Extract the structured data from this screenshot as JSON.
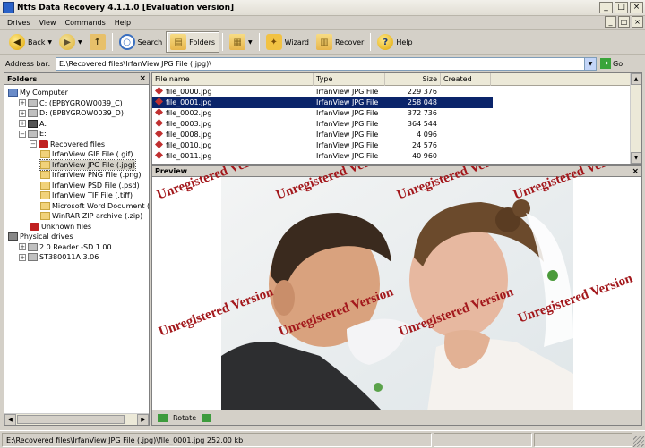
{
  "window": {
    "title": "Ntfs Data Recovery 4.1.1.0 [Evaluation version]",
    "btn_min": "_",
    "btn_max": "□",
    "btn_close": "×"
  },
  "menu": {
    "items": [
      "Drives",
      "View",
      "Commands",
      "Help"
    ]
  },
  "toolbar": {
    "back": "Back",
    "search": "Search",
    "folders": "Folders",
    "wizard": "Wizard",
    "recover": "Recover",
    "help": "Help"
  },
  "address": {
    "label": "Address bar:",
    "value": "E:\\Recovered files\\IrfanView JPG File (.jpg)\\",
    "go": "Go"
  },
  "folders": {
    "title": "Folders",
    "tree": [
      {
        "label": "My Computer",
        "icon": "computer-icon",
        "indent": 0,
        "exp": ""
      },
      {
        "label": "C: (EPBYGROW0039_C)",
        "icon": "drive-icon",
        "indent": 1,
        "exp": "+"
      },
      {
        "label": "D: (EPBYGROW0039_D)",
        "icon": "drive-icon",
        "indent": 1,
        "exp": "+"
      },
      {
        "label": "A:",
        "icon": "floppy-icon",
        "indent": 1,
        "exp": "+"
      },
      {
        "label": "E:",
        "icon": "drive-icon",
        "indent": 1,
        "exp": "−"
      },
      {
        "label": "Recovered files",
        "icon": "recovered-files-icon",
        "indent": 2,
        "exp": "−"
      },
      {
        "label": "IrfanView GIF File (.gif)",
        "icon": "folder-icon",
        "indent": 3,
        "exp": ""
      },
      {
        "label": "IrfanView JPG File (.jpg)",
        "icon": "folder-icon",
        "indent": 3,
        "exp": "",
        "selected": true
      },
      {
        "label": "IrfanView PNG File (.png)",
        "icon": "folder-icon",
        "indent": 3,
        "exp": ""
      },
      {
        "label": "IrfanView PSD File (.psd)",
        "icon": "folder-icon",
        "indent": 3,
        "exp": ""
      },
      {
        "label": "IrfanView TIF File (.tiff)",
        "icon": "folder-icon",
        "indent": 3,
        "exp": ""
      },
      {
        "label": "Microsoft Word Document (.d",
        "icon": "folder-icon",
        "indent": 3,
        "exp": ""
      },
      {
        "label": "WinRAR ZIP archive (.zip)",
        "icon": "folder-icon",
        "indent": 3,
        "exp": ""
      },
      {
        "label": "Unknown files",
        "icon": "unknown-files-icon",
        "indent": 2,
        "exp": ""
      },
      {
        "label": "Physical drives",
        "icon": "physical-drives-icon",
        "indent": 0,
        "exp": ""
      },
      {
        "label": "2.0 Reader   -SD 1.00",
        "icon": "drive-icon",
        "indent": 1,
        "exp": "+"
      },
      {
        "label": "ST380011A 3.06",
        "icon": "drive-icon",
        "indent": 1,
        "exp": "+"
      }
    ]
  },
  "filelist": {
    "columns": [
      "File name",
      "Type",
      "Size",
      "Created"
    ],
    "rows": [
      {
        "name": "file_0000.jpg",
        "type": "IrfanView JPG File",
        "size": "229 376"
      },
      {
        "name": "file_0001.jpg",
        "type": "IrfanView JPG File",
        "size": "258 048",
        "selected": true
      },
      {
        "name": "file_0002.jpg",
        "type": "IrfanView JPG File",
        "size": "372 736"
      },
      {
        "name": "file_0003.jpg",
        "type": "IrfanView JPG File",
        "size": "364 544"
      },
      {
        "name": "file_0008.jpg",
        "type": "IrfanView JPG File",
        "size": "4 096"
      },
      {
        "name": "file_0010.jpg",
        "type": "IrfanView JPG File",
        "size": "24 576"
      },
      {
        "name": "file_0011.jpg",
        "type": "IrfanView JPG File",
        "size": "40 960"
      }
    ]
  },
  "preview": {
    "title": "Preview",
    "watermark": "Unregistered Version",
    "rotate": "Rotate"
  },
  "status": {
    "text": "E:\\Recovered files\\IrfanView JPG File (.jpg)\\file_0001.jpg 252.00 kb"
  }
}
